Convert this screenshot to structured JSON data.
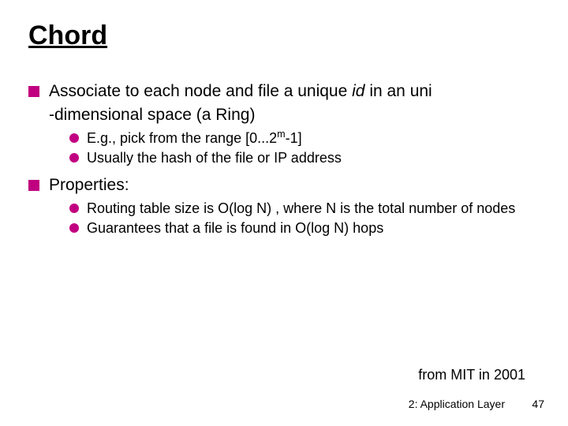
{
  "title": "Chord",
  "bullets": {
    "b1_pre": "Associate to each node and file a unique ",
    "b1_id": "id",
    "b1_mid": " in an uni",
    "b1_line2": "-dimensional space (a Ring)",
    "b1_s1_pre": "E.g., pick from the range [0...2",
    "b1_s1_sup": "m",
    "b1_s1_post": "-1]",
    "b1_s2": "Usually the hash of the file or IP address",
    "b2": "Properties:",
    "b2_s1": "Routing table size is O(log N) , where N is the total number of nodes",
    "b2_s2": "Guarantees that a file is found in O(log N) hops"
  },
  "attribution": "from MIT in 2001",
  "footer_label": "2: Application Layer",
  "page_number": "47"
}
